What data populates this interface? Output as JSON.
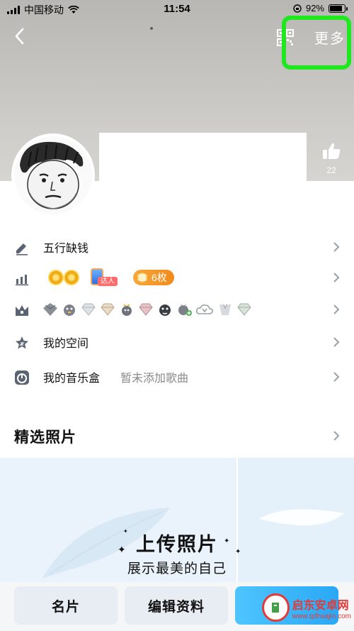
{
  "status_bar": {
    "carrier": "中国移动",
    "time": "11:54",
    "battery_text": "92%",
    "battery_level": 0.92
  },
  "nav": {
    "back_icon": "chevron-left-icon",
    "qr_icon": "qr-code-icon",
    "more_label": "更多",
    "highlight_color": "#1fe81f"
  },
  "profile": {
    "like_count": "22",
    "avatar_icon": "cartoon-face-avatar"
  },
  "rows": [
    {
      "icon": "pencil-icon",
      "label": "五行缺钱"
    },
    {
      "icon": "level-chart-icon",
      "talent_tag": "达人",
      "coins_label": "6枚"
    },
    {
      "icon": "crown-icon"
    },
    {
      "icon": "star-icon",
      "label": "我的空间"
    },
    {
      "icon": "music-box-icon",
      "label": "我的音乐盒",
      "sub": "暂未添加歌曲"
    }
  ],
  "section": {
    "title": "精选照片"
  },
  "upload": {
    "title": "上传照片",
    "subtitle": "展示最美的自己"
  },
  "bottom_bar": {
    "card_label": "名片",
    "edit_label": "编辑资料"
  },
  "watermark": {
    "name": "启东安卓网",
    "url": "www.qdhuajin.com"
  },
  "colors": {
    "accent_blue": "#2aa8f5",
    "coin_orange": "#f28a1a"
  }
}
